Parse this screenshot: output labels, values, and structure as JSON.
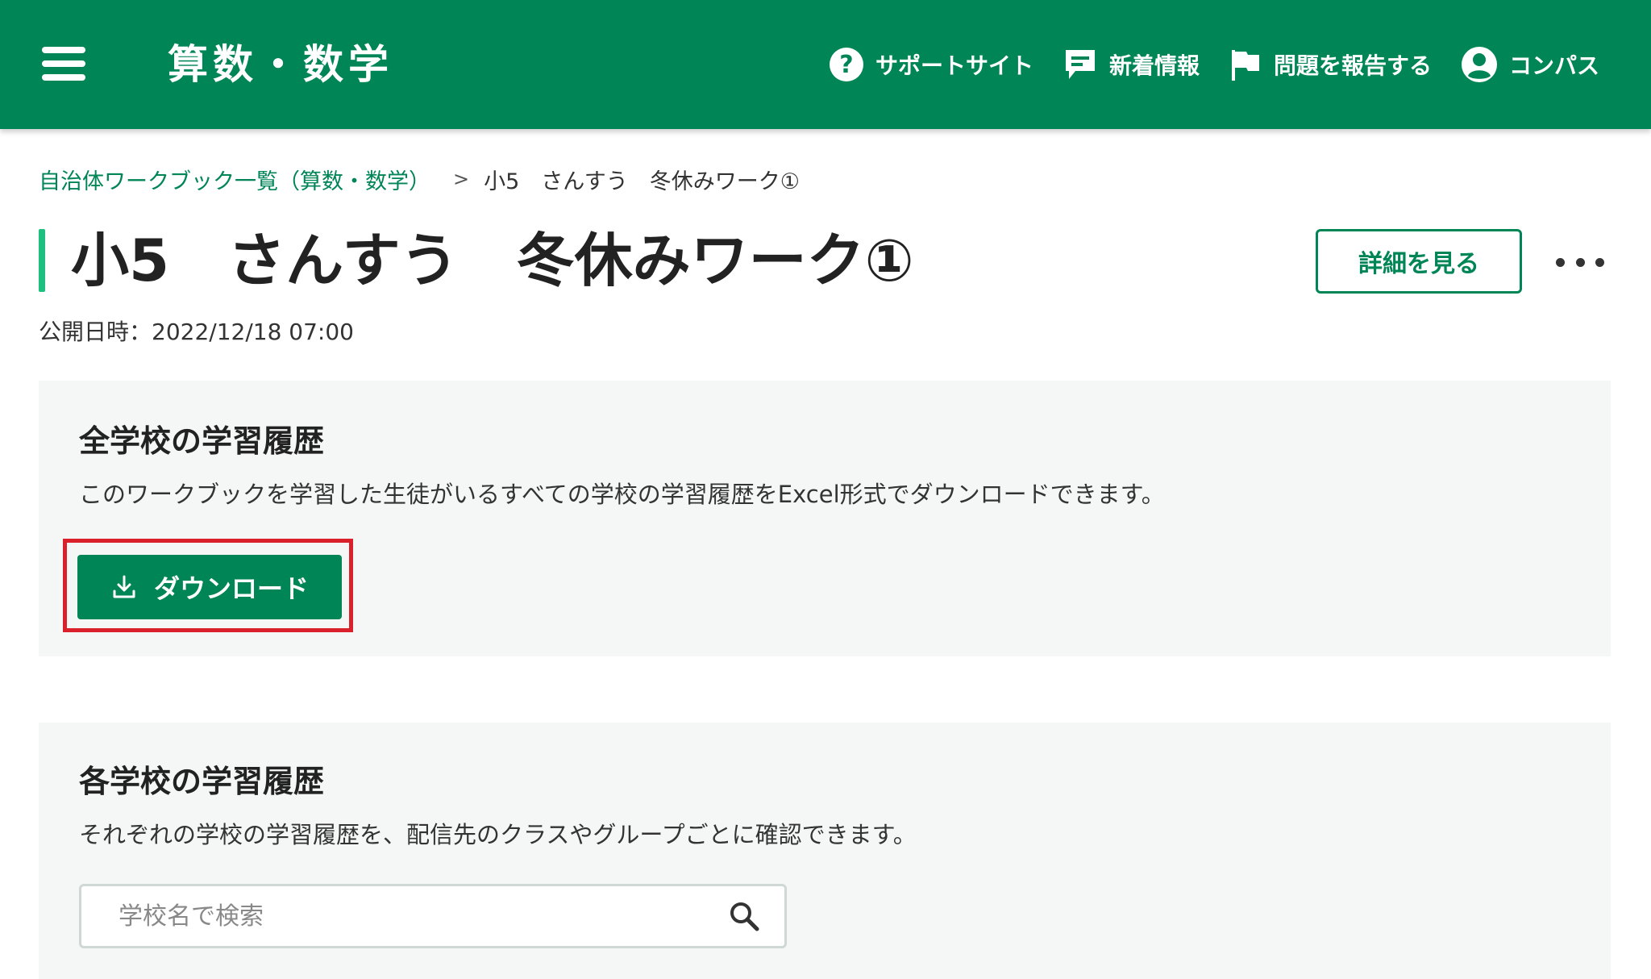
{
  "header": {
    "app_title": "算数・数学",
    "nav": [
      {
        "label": "サポートサイト",
        "icon": "help-circle-icon"
      },
      {
        "label": "新着情報",
        "icon": "chat-bubble-icon"
      },
      {
        "label": "問題を報告する",
        "icon": "flag-icon"
      },
      {
        "label": "コンパス",
        "icon": "account-circle-icon"
      }
    ]
  },
  "breadcrumb": {
    "parent": "自治体ワークブック一覧（算数・数学）",
    "separator": ">",
    "current": "小5　さんすう　冬休みワーク①"
  },
  "page": {
    "title": "小5　さんすう　冬休みワーク①",
    "detail_button": "詳細を見る",
    "published": "公開日時：2022/12/18 07:00"
  },
  "all_schools": {
    "heading": "全学校の学習履歴",
    "description": "このワークブックを学習した生徒がいるすべての学校の学習履歴をExcel形式でダウンロードできます。",
    "download_button": "ダウンロード"
  },
  "each_school": {
    "heading": "各学校の学習履歴",
    "description": "それぞれの学校の学習履歴を、配信先のクラスやグループごとに確認できます。",
    "search_placeholder": "学校名で検索"
  },
  "colors": {
    "brand": "#008557",
    "accent_bar": "#1ec07f",
    "highlight": "#d9202b"
  }
}
